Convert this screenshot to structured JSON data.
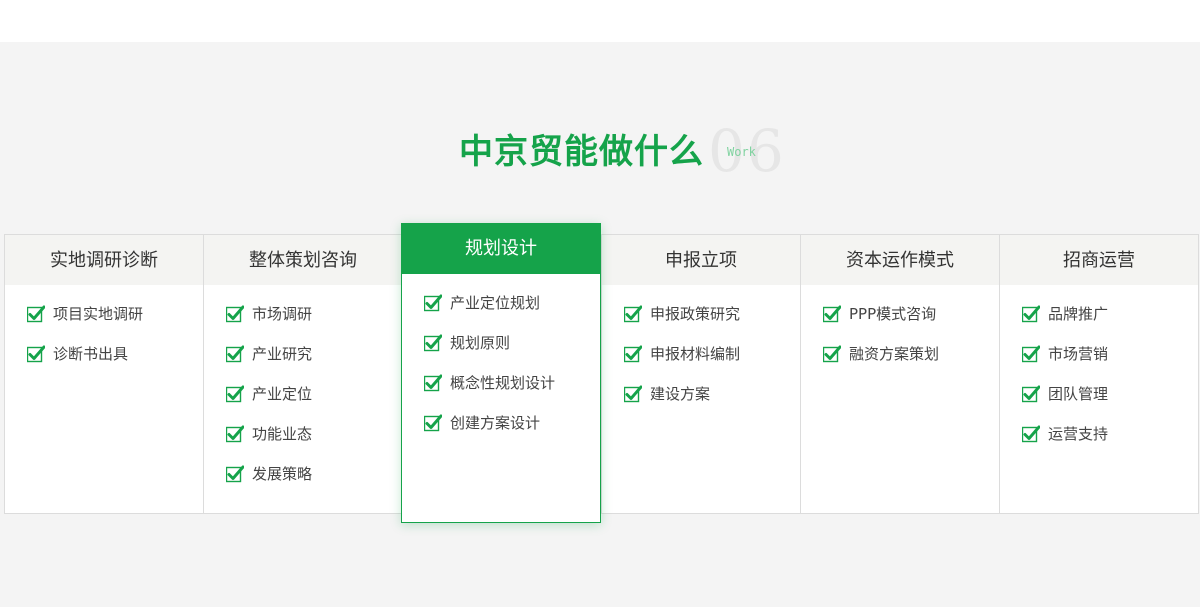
{
  "heading": {
    "title": "中京贸能做什么",
    "number": "06",
    "sub": "Work"
  },
  "colors": {
    "accent": "#15a34a",
    "background": "#f4f4f4",
    "card_header": "#f4f4f2"
  },
  "icons": {
    "list_bullet": "check-icon"
  },
  "cards": [
    {
      "title": "实地调研诊断",
      "items": [
        "项目实地调研",
        "诊断书出具"
      ]
    },
    {
      "title": "整体策划咨询",
      "items": [
        "市场调研",
        "产业研究",
        "产业定位",
        "功能业态",
        "发展策略"
      ]
    },
    {
      "title": "规划设计",
      "active": true,
      "items": [
        "产业定位规划",
        "规划原则",
        "概念性规划设计",
        "创建方案设计"
      ]
    },
    {
      "title": "申报立项",
      "items": [
        "申报政策研究",
        "申报材料编制",
        "建设方案"
      ]
    },
    {
      "title": "资本运作模式",
      "items": [
        "PPP模式咨询",
        "融资方案策划"
      ]
    },
    {
      "title": "招商运营",
      "items": [
        "品牌推广",
        "市场营销",
        "团队管理",
        "运营支持"
      ]
    }
  ]
}
